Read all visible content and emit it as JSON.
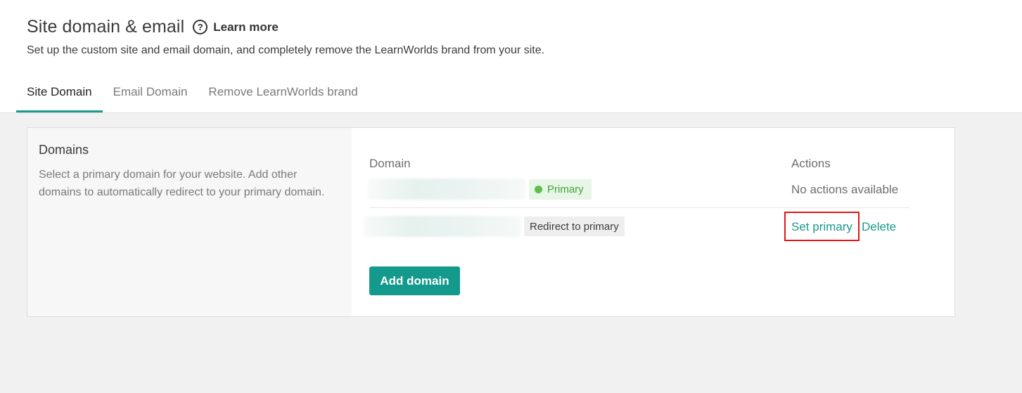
{
  "header": {
    "title": "Site domain & email",
    "learn_more_label": "Learn more",
    "subtitle": "Set up the custom site and email domain, and completely remove the LearnWorlds brand from your site."
  },
  "tabs": [
    {
      "label": "Site Domain",
      "active": true
    },
    {
      "label": "Email Domain",
      "active": false
    },
    {
      "label": "Remove LearnWorlds brand",
      "active": false
    }
  ],
  "domains_section": {
    "title": "Domains",
    "description": "Select a primary domain for your website. Add other domains to automatically redirect to your primary domain."
  },
  "table": {
    "columns": {
      "domain": "Domain",
      "actions": "Actions"
    },
    "rows": [
      {
        "domain": "",
        "status": "Primary",
        "actions_text": "No actions available"
      },
      {
        "domain": "",
        "status": "Redirect to primary",
        "actions": [
          "Set primary",
          "Delete"
        ]
      }
    ]
  },
  "add_domain_label": "Add domain",
  "colors": {
    "accent": "#149a8c",
    "primary_badge": "#e7f6e6",
    "primary_dot": "#5fbf4a",
    "highlight": "#e01616"
  },
  "icons": {
    "learn_more": "help-circle-icon",
    "primary_status": "green-dot-icon"
  }
}
